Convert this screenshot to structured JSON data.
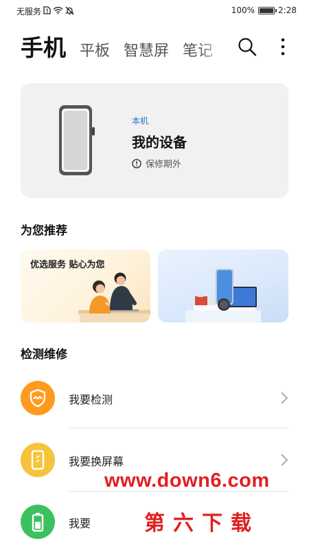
{
  "status_bar": {
    "carrier": "无服务",
    "battery": "100%",
    "battery_level": 1.0,
    "time": "2:28"
  },
  "tabs": [
    {
      "label": "手机",
      "active": true
    },
    {
      "label": "平板",
      "active": false
    },
    {
      "label": "智慧屏",
      "active": false
    },
    {
      "label": "笔记",
      "active": false
    }
  ],
  "toolbar": {
    "search_icon": "search-icon",
    "more_icon": "more-vertical-icon"
  },
  "device_card": {
    "tag": "本机",
    "name": "我的设备",
    "warranty": "保修期外",
    "warranty_icon": "info-circle-icon"
  },
  "recommend": {
    "title": "为您推荐",
    "cards": [
      {
        "text": "优选服务 贴心为您"
      },
      {
        "text": ""
      }
    ]
  },
  "repair": {
    "title": "检测维修",
    "items": [
      {
        "label": "我要检测",
        "icon": "shield-check-icon",
        "color": "#ff9a1f"
      },
      {
        "label": "我要换屏幕",
        "icon": "phone-screen-icon",
        "color": "#f7c33a"
      },
      {
        "label": "我要",
        "icon": "battery-icon",
        "color": "#3dc160"
      }
    ]
  },
  "watermark": {
    "url": "www.down6.com",
    "name": "第六下载"
  }
}
